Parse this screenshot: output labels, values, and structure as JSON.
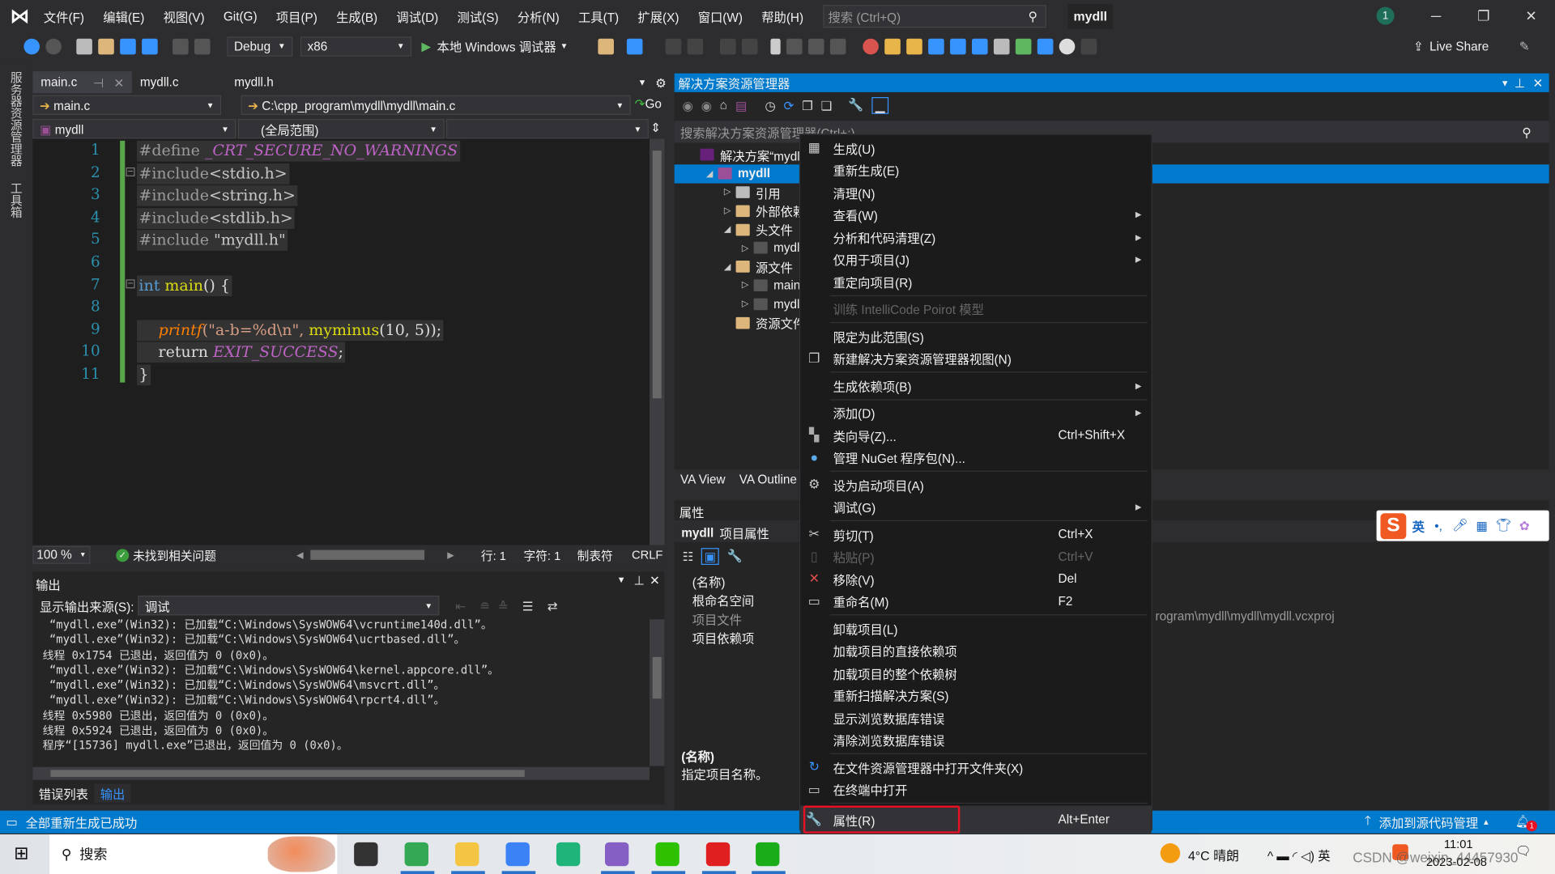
{
  "menubar": {
    "items": [
      "文件(F)",
      "编辑(E)",
      "视图(V)",
      "Git(G)",
      "项目(P)",
      "生成(B)",
      "调试(D)",
      "测试(S)",
      "分析(N)",
      "工具(T)",
      "扩展(X)",
      "窗口(W)",
      "帮助(H)"
    ],
    "search_placeholder": "搜索 (Ctrl+Q)",
    "solution_name": "mydll",
    "notification_count": "1"
  },
  "toolbar": {
    "config": "Debug",
    "platform": "x86",
    "debugger": "本地 Windows 调试器",
    "live_share": "Live Share"
  },
  "left_rail": {
    "server_explorer": "服务器资源管理器",
    "toolbox": "工具箱"
  },
  "editor": {
    "tabs": [
      "main.c",
      "mydll.c",
      "mydll.h"
    ],
    "file_combo": "main.c",
    "path_combo": "C:\\cpp_program\\mydll\\mydll\\main.c",
    "go_label": "Go",
    "project_combo": "mydll",
    "scope_combo": "(全局范围)",
    "lines": [
      [
        [
          "pp",
          "#define "
        ],
        [
          "mac",
          "_CRT_SECURE_NO_WARNINGS"
        ]
      ],
      [
        [
          "pp",
          "#include"
        ],
        [
          "inc",
          "<stdio.h>"
        ]
      ],
      [
        [
          "pp",
          "#include"
        ],
        [
          "inc",
          "<string.h>"
        ]
      ],
      [
        [
          "pp",
          "#include"
        ],
        [
          "inc",
          "<stdlib.h>"
        ]
      ],
      [
        [
          "pp",
          "#include "
        ],
        [
          "inc",
          "\"mydll.h\""
        ]
      ],
      [],
      [
        [
          "kw",
          "int "
        ],
        [
          "fnd",
          "main"
        ],
        [
          "txt",
          "() {"
        ]
      ],
      [],
      [
        [
          "txt",
          "    "
        ],
        [
          "fn",
          "printf"
        ],
        [
          "str",
          "(\"a-b=%d\\n\", "
        ],
        [
          "fnd",
          "myminus"
        ],
        [
          "txt",
          "(10, 5));"
        ]
      ],
      [
        [
          "txt",
          "    return "
        ],
        [
          "mac",
          "EXIT_SUCCESS"
        ],
        [
          "txt",
          ";"
        ]
      ],
      [
        [
          "txt",
          "}"
        ]
      ]
    ],
    "status": {
      "zoom": "100 %",
      "issues": "未找到相关问题",
      "line": "行: 1",
      "char": "字符: 1",
      "tabs": "制表符",
      "eol": "CRLF"
    }
  },
  "output": {
    "title": "输出",
    "source_label": "显示输出来源(S):",
    "source_value": "调试",
    "lines": [
      " “mydll.exe”(Win32): 已加载“C:\\Windows\\SysWOW64\\vcruntime140d.dll”。",
      " “mydll.exe”(Win32): 已加载“C:\\Windows\\SysWOW64\\ucrtbased.dll”。",
      "线程 0x1754 已退出，返回值为 0 (0x0)。",
      " “mydll.exe”(Win32): 已加载“C:\\Windows\\SysWOW64\\kernel.appcore.dll”。",
      " “mydll.exe”(Win32): 已加载“C:\\Windows\\SysWOW64\\msvcrt.dll”。",
      " “mydll.exe”(Win32): 已加载“C:\\Windows\\SysWOW64\\rpcrt4.dll”。",
      "线程 0x5980 已退出，返回值为 0 (0x0)。",
      "线程 0x5924 已退出，返回值为 0 (0x0)。",
      "程序“[15736] mydll.exe”已退出，返回值为 0 (0x0)。"
    ],
    "tabs": [
      "错误列表",
      "输出"
    ]
  },
  "solution_explorer": {
    "title": "解决方案资源管理器",
    "search_placeholder": "搜索解决方案资源管理器(Ctrl+;)",
    "tree": [
      {
        "label": "解决方案“mydll",
        "indent": 0,
        "arrow": "",
        "icon": "solution-icon",
        "color": "#68217a"
      },
      {
        "label": "mydll",
        "indent": 1,
        "arrow": "◢",
        "icon": "project-icon",
        "color": "#9b4f96",
        "selected": true
      },
      {
        "label": "引用",
        "indent": 2,
        "arrow": "▷",
        "icon": "references-icon",
        "color": "#bbbbbb"
      },
      {
        "label": "外部依赖",
        "indent": 2,
        "arrow": "▷",
        "icon": "folder-icon",
        "color": "#dcb67a"
      },
      {
        "label": "头文件",
        "indent": 2,
        "arrow": "◢",
        "icon": "filter-folder-icon",
        "color": "#dcb67a"
      },
      {
        "label": "mydll",
        "indent": 3,
        "arrow": "▷",
        "icon": "header-file-icon",
        "color": "#555555"
      },
      {
        "label": "源文件",
        "indent": 2,
        "arrow": "◢",
        "icon": "filter-folder-icon",
        "color": "#dcb67a"
      },
      {
        "label": "main.",
        "indent": 3,
        "arrow": "▷",
        "icon": "c-file-icon",
        "color": "#555555"
      },
      {
        "label": "mydll",
        "indent": 3,
        "arrow": "▷",
        "icon": "c-file-icon",
        "color": "#555555"
      },
      {
        "label": "资源文件",
        "indent": 2,
        "arrow": "",
        "icon": "filter-folder-icon",
        "color": "#dcb67a"
      }
    ],
    "bottom_tabs": [
      "VA View",
      "VA Outline"
    ]
  },
  "properties": {
    "title": "属性",
    "object": "mydll",
    "object_type": "项目属性",
    "rows": [
      {
        "name": "(名称)",
        "value": ""
      },
      {
        "name": "根命名空间",
        "value": ""
      },
      {
        "name": "项目文件",
        "value": "rogram\\mydll\\mydll\\mydll.vcxproj",
        "dim": true
      },
      {
        "name": "项目依赖项",
        "value": ""
      }
    ],
    "desc_title": "(名称)",
    "desc_text": "指定项目名称。"
  },
  "context_menu": {
    "items": [
      {
        "label": "生成(U)",
        "icon": "build-icon"
      },
      {
        "label": "重新生成(E)"
      },
      {
        "label": "清理(N)"
      },
      {
        "label": "查看(W)",
        "submenu": true
      },
      {
        "label": "分析和代码清理(Z)",
        "submenu": true
      },
      {
        "label": "仅用于项目(J)",
        "submenu": true
      },
      {
        "label": "重定向项目(R)"
      },
      {
        "sep": true
      },
      {
        "label": "训练 IntelliCode Poirot 模型",
        "disabled": true
      },
      {
        "sep": true
      },
      {
        "label": "限定为此范围(S)"
      },
      {
        "label": "新建解决方案资源管理器视图(N)",
        "icon": "new-view-icon"
      },
      {
        "sep": true
      },
      {
        "label": "生成依赖项(B)",
        "submenu": true
      },
      {
        "sep": true
      },
      {
        "label": "添加(D)",
        "submenu": true
      },
      {
        "label": "类向导(Z)...",
        "shortcut": "Ctrl+Shift+X",
        "icon": "class-wizard-icon"
      },
      {
        "label": "管理 NuGet 程序包(N)...",
        "icon": "nuget-icon"
      },
      {
        "sep": true
      },
      {
        "label": "设为启动项目(A)",
        "icon": "gear-icon"
      },
      {
        "label": "调试(G)",
        "submenu": true
      },
      {
        "sep": true
      },
      {
        "label": "剪切(T)",
        "shortcut": "Ctrl+X",
        "icon": "scissors-icon"
      },
      {
        "label": "粘贴(P)",
        "shortcut": "Ctrl+V",
        "icon": "paste-icon",
        "disabled": true
      },
      {
        "label": "移除(V)",
        "shortcut": "Del",
        "icon": "remove-icon"
      },
      {
        "label": "重命名(M)",
        "shortcut": "F2",
        "icon": "rename-icon"
      },
      {
        "sep": true
      },
      {
        "label": "卸载项目(L)"
      },
      {
        "label": "加载项目的直接依赖项"
      },
      {
        "label": "加载项目的整个依赖树"
      },
      {
        "label": "重新扫描解决方案(S)"
      },
      {
        "label": "显示浏览数据库错误"
      },
      {
        "label": "清除浏览数据库错误"
      },
      {
        "sep": true
      },
      {
        "label": "在文件资源管理器中打开文件夹(X)",
        "icon": "open-folder-icon"
      },
      {
        "label": "在终端中打开",
        "icon": "terminal-icon"
      },
      {
        "sep": true
      },
      {
        "label": "属性(R)",
        "shortcut": "Alt+Enter",
        "icon": "wrench-icon",
        "highlighted": true
      }
    ]
  },
  "ime": {
    "mode": "英"
  },
  "statusbar": {
    "message": "全部重新生成已成功",
    "source_control": "添加到源代码管理",
    "bell_count": "1"
  },
  "taskbar": {
    "search": "搜索",
    "weather": "4°C 晴朗",
    "time": "11:01",
    "date": "2023-02-08",
    "watermark": "CSDN @weixin_44457930",
    "apps": [
      {
        "name": "task-view-icon",
        "color": "#333333"
      },
      {
        "name": "chrome-icon",
        "color": "#34a853"
      },
      {
        "name": "file-explorer-icon",
        "color": "#f4c542"
      },
      {
        "name": "baidu-netdisk-icon",
        "color": "#3b82f6"
      },
      {
        "name": "app-icon",
        "color": "#1fb57a"
      },
      {
        "name": "visual-studio-icon",
        "color": "#865fc5"
      },
      {
        "name": "wechat-icon",
        "color": "#2dc100"
      },
      {
        "name": "wps-icon",
        "color": "#e02020"
      },
      {
        "name": "green-app-icon",
        "color": "#1aad19"
      }
    ]
  },
  "colors": {
    "accent": "#007acc",
    "highlight_box": "#e81123",
    "menu_bg": "#1b1b1c"
  }
}
